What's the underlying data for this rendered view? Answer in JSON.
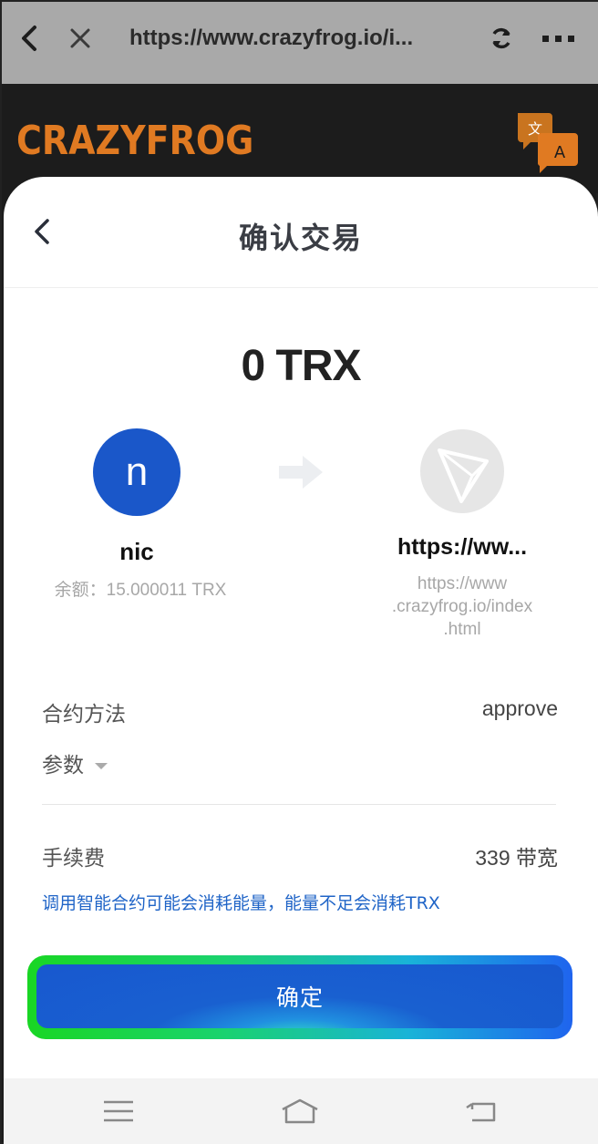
{
  "browser": {
    "url": "https://www.crazyfrog.io/i...",
    "back_icon": "back-arrow-icon",
    "close_icon": "close-icon",
    "refresh_icon": "refresh-icon",
    "more_icon": "more-horizontal-icon"
  },
  "site": {
    "logo_text": "CRAZYFROG",
    "logo_color": "#e07a22",
    "translate_icon": "translate-icon"
  },
  "sheet": {
    "title": "确认交易",
    "amount": "0 TRX",
    "from": {
      "avatar_letter": "n",
      "name": "nic",
      "balance": "余额：15.000011 TRX",
      "avatar_color": "#1a57c9"
    },
    "to": {
      "name": "https://ww...",
      "url_lines": [
        "https://www",
        ".crazyfrog.io/index",
        ".html"
      ]
    },
    "rows": {
      "method_label": "合约方法",
      "method_value": "approve",
      "params_label": "参数",
      "fee_label": "手续费",
      "fee_value": "339 带宽"
    },
    "energy_note": "调用智能合约可能会消耗能量，能量不足会消耗TRX",
    "confirm_label": "确定",
    "accent_color": "#1858cf"
  },
  "nav": {
    "menu_icon": "menu-icon",
    "home_icon": "home-icon",
    "back_icon": "return-icon"
  }
}
